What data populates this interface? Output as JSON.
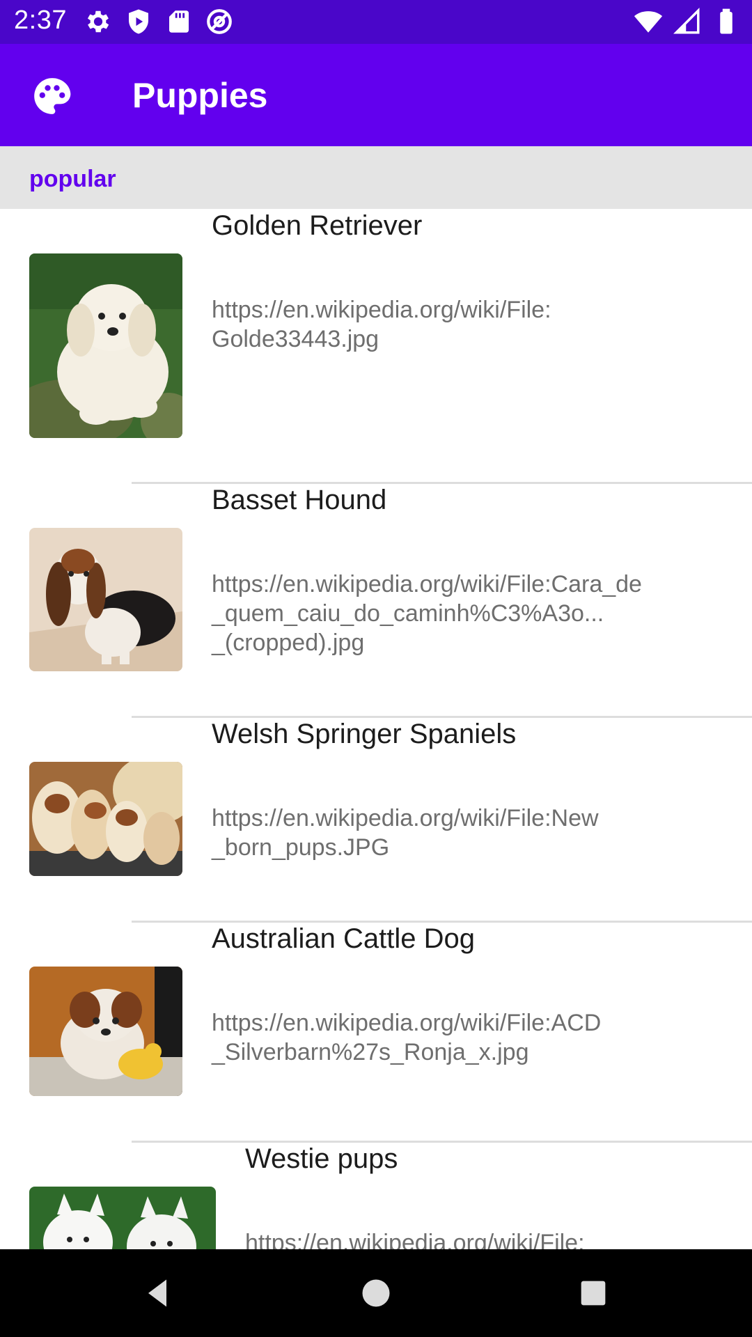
{
  "status_bar": {
    "time": "2:37",
    "left_icons": [
      "settings-icon",
      "play-protect-icon",
      "sd-card-icon",
      "at-sign-icon"
    ],
    "right_icons": [
      "wifi-icon",
      "signal-icon",
      "battery-icon"
    ]
  },
  "app_bar": {
    "title": "Puppies",
    "nav_icon": "palette-icon",
    "color": "#6200ee"
  },
  "section": {
    "label": "popular"
  },
  "items": [
    {
      "title": "Golden Retriever",
      "url_lines": [
        "https://en.wikipedia.org/wiki/File:",
        "Golde33443.jpg"
      ]
    },
    {
      "title": "Basset Hound",
      "url_lines": [
        "https://en.wikipedia.org/wiki/File:Cara_de",
        "_quem_caiu_do_caminh%C3%A3o...",
        "_(cropped).jpg"
      ]
    },
    {
      "title": "Welsh Springer Spaniels",
      "url_lines": [
        "https://en.wikipedia.org/wiki/File:New",
        "_born_pups.JPG"
      ]
    },
    {
      "title": "Australian Cattle Dog",
      "url_lines": [
        "https://en.wikipedia.org/wiki/File:ACD",
        "_Silverbarn%27s_Ronja_x.jpg"
      ]
    },
    {
      "title": "Westie pups",
      "url_lines": [
        "https://en.wikipedia.org/wiki/File:"
      ]
    }
  ],
  "nav_bar": {
    "buttons": [
      "back-icon",
      "home-icon",
      "recents-icon"
    ]
  }
}
